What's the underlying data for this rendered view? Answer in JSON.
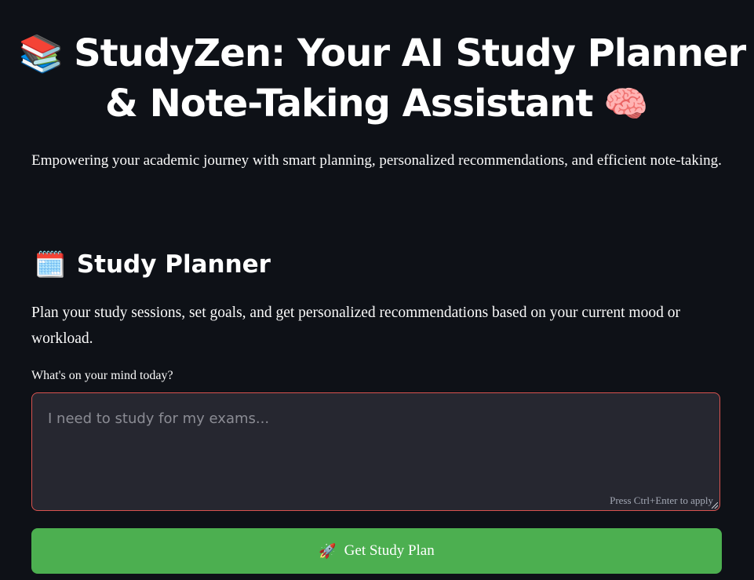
{
  "header": {
    "icon_left": "books-icon",
    "icon_left_glyph": "📚",
    "title_line1": "StudyZen: Your AI Study Planner",
    "title_line2": "& Note-Taking Assistant",
    "icon_right": "brain-icon",
    "icon_right_glyph": "🧠",
    "subtitle": "Empowering your academic journey with smart planning, personalized recommendations, and efficient note-taking."
  },
  "planner": {
    "icon": "calendar-icon",
    "icon_glyph": "🗓️",
    "heading": "Study Planner",
    "description": "Plan your study sessions, set goals, and get personalized recommendations based on your current mood or workload.",
    "input_label": "What's on your mind today?",
    "input_value": "",
    "input_placeholder": "I need to study for my exams...",
    "input_hint": "Press Ctrl+Enter to apply",
    "button_icon": "rocket-icon",
    "button_icon_glyph": "🚀",
    "button_label": "Get Study Plan"
  },
  "colors": {
    "background": "#0e1117",
    "input_background": "#262730",
    "input_border": "#d9534f",
    "button_background": "#4caf50"
  }
}
